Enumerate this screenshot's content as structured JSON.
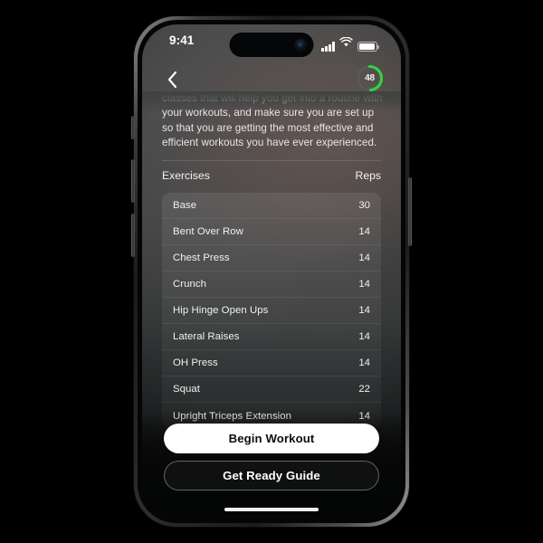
{
  "status_bar": {
    "time": "9:41",
    "cellular_icon": "cellular-bars-icon",
    "wifi_icon": "wifi-icon",
    "battery_icon": "battery-icon"
  },
  "nav": {
    "back_icon": "chevron-left-icon",
    "progress_ring": {
      "value": "48",
      "percent": 48,
      "track_color": "#57595a",
      "accent_color": "#2fd63f"
    }
  },
  "intro": {
    "clipped_line": "classes that will help you get into a routine with",
    "text": "your workouts, and make sure you are set up so that you are getting the most effective and efficient workouts you have ever experienced."
  },
  "table": {
    "header": {
      "exercises": "Exercises",
      "reps": "Reps"
    },
    "rows": [
      {
        "name": "Base",
        "reps": "30"
      },
      {
        "name": "Bent Over Row",
        "reps": "14"
      },
      {
        "name": "Chest Press",
        "reps": "14"
      },
      {
        "name": "Crunch",
        "reps": "14"
      },
      {
        "name": "Hip Hinge Open Ups",
        "reps": "14"
      },
      {
        "name": "Lateral Raises",
        "reps": "14"
      },
      {
        "name": "OH Press",
        "reps": "14"
      },
      {
        "name": "Squat",
        "reps": "22"
      },
      {
        "name": "Upright Triceps Extension",
        "reps": "14"
      }
    ]
  },
  "actions": {
    "primary_label": "Begin Workout",
    "secondary_label": "Get Ready Guide"
  }
}
